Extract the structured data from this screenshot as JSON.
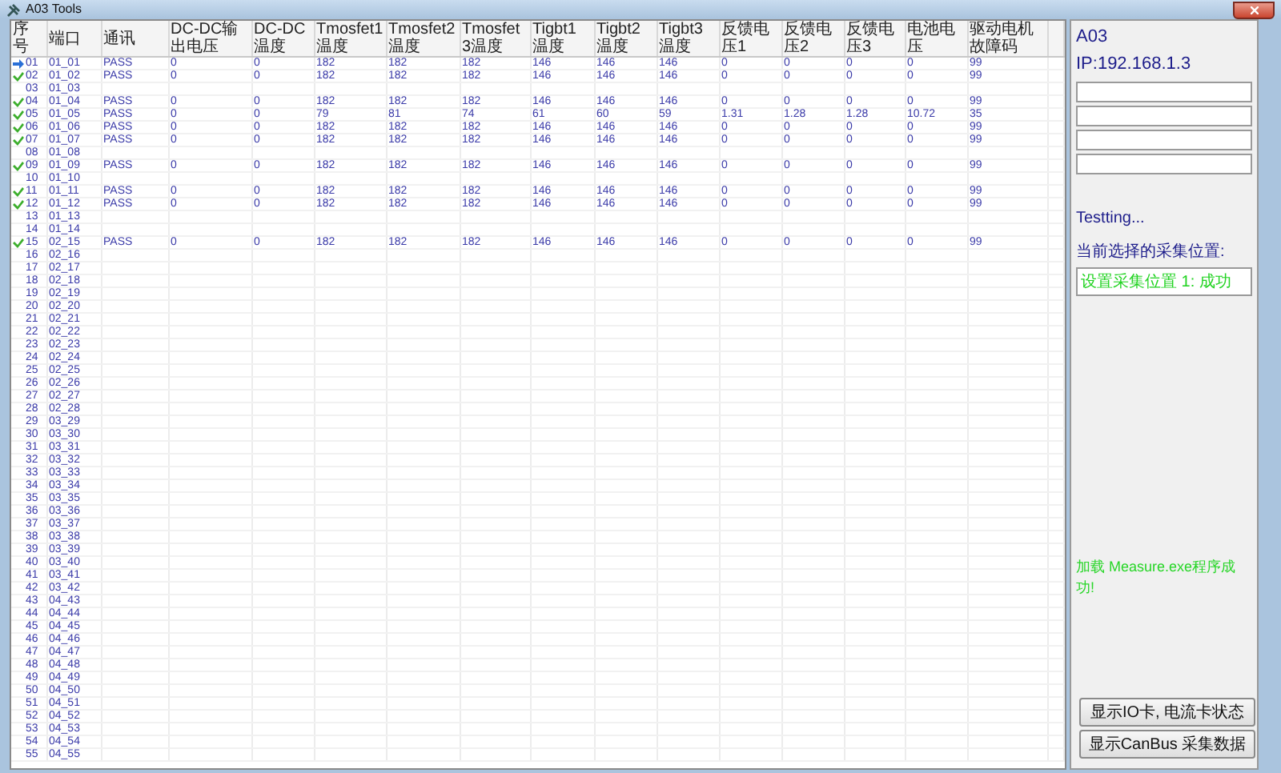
{
  "window": {
    "title": "A03 Tools"
  },
  "table": {
    "columns": [
      "序号",
      "端口",
      "通讯",
      "DC-DC输出电压",
      "DC-DC温度",
      "Tmosfet1温度",
      "Tmosfet2温度",
      "Tmosfet3温度",
      "Tigbt1温度",
      "Tigbt2温度",
      "Tigbt3温度",
      "反馈电压1",
      "反馈电压2",
      "反馈电压3",
      "电池电压",
      "驱动电机故障码"
    ],
    "rows": [
      {
        "kind": "current",
        "cells": [
          "01",
          "01_01",
          "PASS",
          "0",
          "0",
          "182",
          "182",
          "182",
          "146",
          "146",
          "146",
          "0",
          "0",
          "0",
          "0",
          "99"
        ]
      },
      {
        "kind": "passed",
        "cells": [
          "02",
          "01_02",
          "PASS",
          "0",
          "0",
          "182",
          "182",
          "182",
          "146",
          "146",
          "146",
          "0",
          "0",
          "0",
          "0",
          "99"
        ]
      },
      {
        "kind": "plain",
        "cells": [
          "03",
          "01_03"
        ]
      },
      {
        "kind": "passed",
        "cells": [
          "04",
          "01_04",
          "PASS",
          "0",
          "0",
          "182",
          "182",
          "182",
          "146",
          "146",
          "146",
          "0",
          "0",
          "0",
          "0",
          "99"
        ]
      },
      {
        "kind": "passed",
        "cells": [
          "05",
          "01_05",
          "PASS",
          "0",
          "0",
          "79",
          "81",
          "74",
          "61",
          "60",
          "59",
          "1.31",
          "1.28",
          "1.28",
          "10.72",
          "35"
        ]
      },
      {
        "kind": "passed",
        "cells": [
          "06",
          "01_06",
          "PASS",
          "0",
          "0",
          "182",
          "182",
          "182",
          "146",
          "146",
          "146",
          "0",
          "0",
          "0",
          "0",
          "99"
        ]
      },
      {
        "kind": "passed",
        "cells": [
          "07",
          "01_07",
          "PASS",
          "0",
          "0",
          "182",
          "182",
          "182",
          "146",
          "146",
          "146",
          "0",
          "0",
          "0",
          "0",
          "99"
        ]
      },
      {
        "kind": "plain",
        "cells": [
          "08",
          "01_08"
        ]
      },
      {
        "kind": "passed",
        "cells": [
          "09",
          "01_09",
          "PASS",
          "0",
          "0",
          "182",
          "182",
          "182",
          "146",
          "146",
          "146",
          "0",
          "0",
          "0",
          "0",
          "99"
        ]
      },
      {
        "kind": "plain",
        "cells": [
          "10",
          "01_10"
        ]
      },
      {
        "kind": "passed",
        "cells": [
          "11",
          "01_11",
          "PASS",
          "0",
          "0",
          "182",
          "182",
          "182",
          "146",
          "146",
          "146",
          "0",
          "0",
          "0",
          "0",
          "99"
        ]
      },
      {
        "kind": "passed",
        "cells": [
          "12",
          "01_12",
          "PASS",
          "0",
          "0",
          "182",
          "182",
          "182",
          "146",
          "146",
          "146",
          "0",
          "0",
          "0",
          "0",
          "99"
        ]
      },
      {
        "kind": "plain",
        "cells": [
          "13",
          "01_13"
        ]
      },
      {
        "kind": "plain",
        "cells": [
          "14",
          "01_14"
        ]
      },
      {
        "kind": "passed",
        "cells": [
          "15",
          "02_15",
          "PASS",
          "0",
          "0",
          "182",
          "182",
          "182",
          "146",
          "146",
          "146",
          "0",
          "0",
          "0",
          "0",
          "99"
        ]
      },
      {
        "kind": "plain",
        "cells": [
          "16",
          "02_16"
        ]
      },
      {
        "kind": "plain",
        "cells": [
          "17",
          "02_17"
        ]
      },
      {
        "kind": "plain",
        "cells": [
          "18",
          "02_18"
        ]
      },
      {
        "kind": "plain",
        "cells": [
          "19",
          "02_19"
        ]
      },
      {
        "kind": "plain",
        "cells": [
          "20",
          "02_20"
        ]
      },
      {
        "kind": "plain",
        "cells": [
          "21",
          "02_21"
        ]
      },
      {
        "kind": "plain",
        "cells": [
          "22",
          "02_22"
        ]
      },
      {
        "kind": "plain",
        "cells": [
          "23",
          "02_23"
        ]
      },
      {
        "kind": "plain",
        "cells": [
          "24",
          "02_24"
        ]
      },
      {
        "kind": "plain",
        "cells": [
          "25",
          "02_25"
        ]
      },
      {
        "kind": "plain",
        "cells": [
          "26",
          "02_26"
        ]
      },
      {
        "kind": "plain",
        "cells": [
          "27",
          "02_27"
        ]
      },
      {
        "kind": "plain",
        "cells": [
          "28",
          "02_28"
        ]
      },
      {
        "kind": "plain",
        "cells": [
          "29",
          "03_29"
        ]
      },
      {
        "kind": "plain",
        "cells": [
          "30",
          "03_30"
        ]
      },
      {
        "kind": "plain",
        "cells": [
          "31",
          "03_31"
        ]
      },
      {
        "kind": "plain",
        "cells": [
          "32",
          "03_32"
        ]
      },
      {
        "kind": "plain",
        "cells": [
          "33",
          "03_33"
        ]
      },
      {
        "kind": "plain",
        "cells": [
          "34",
          "03_34"
        ]
      },
      {
        "kind": "plain",
        "cells": [
          "35",
          "03_35"
        ]
      },
      {
        "kind": "plain",
        "cells": [
          "36",
          "03_36"
        ]
      },
      {
        "kind": "plain",
        "cells": [
          "37",
          "03_37"
        ]
      },
      {
        "kind": "plain",
        "cells": [
          "38",
          "03_38"
        ]
      },
      {
        "kind": "plain",
        "cells": [
          "39",
          "03_39"
        ]
      },
      {
        "kind": "plain",
        "cells": [
          "40",
          "03_40"
        ]
      },
      {
        "kind": "plain",
        "cells": [
          "41",
          "03_41"
        ]
      },
      {
        "kind": "plain",
        "cells": [
          "42",
          "03_42"
        ]
      },
      {
        "kind": "plain",
        "cells": [
          "43",
          "04_43"
        ]
      },
      {
        "kind": "plain",
        "cells": [
          "44",
          "04_44"
        ]
      },
      {
        "kind": "plain",
        "cells": [
          "45",
          "04_45"
        ]
      },
      {
        "kind": "plain",
        "cells": [
          "46",
          "04_46"
        ]
      },
      {
        "kind": "plain",
        "cells": [
          "47",
          "04_47"
        ]
      },
      {
        "kind": "plain",
        "cells": [
          "48",
          "04_48"
        ]
      },
      {
        "kind": "plain",
        "cells": [
          "49",
          "04_49"
        ]
      },
      {
        "kind": "plain",
        "cells": [
          "50",
          "04_50"
        ]
      },
      {
        "kind": "plain",
        "cells": [
          "51",
          "04_51"
        ]
      },
      {
        "kind": "plain",
        "cells": [
          "52",
          "04_52"
        ]
      },
      {
        "kind": "plain",
        "cells": [
          "53",
          "04_53"
        ]
      },
      {
        "kind": "plain",
        "cells": [
          "54",
          "04_54"
        ]
      },
      {
        "kind": "plain",
        "cells": [
          "55",
          "04_55"
        ]
      }
    ]
  },
  "panel": {
    "device": "A03",
    "ip": "IP:192.168.1.3",
    "fields": [
      {
        "kind": "text"
      },
      {
        "kind": "text"
      },
      {
        "kind": "text"
      },
      {
        "kind": "text"
      }
    ],
    "status": "Testting...",
    "position_label": "当前选择的采集位置:",
    "position_result": "设置采集位置 1: 成功",
    "message": "加载 Measure.exe程序成功!",
    "buttons": [
      "显示IO卡, 电流卡状态",
      "显示CanBus 采集数据"
    ]
  }
}
